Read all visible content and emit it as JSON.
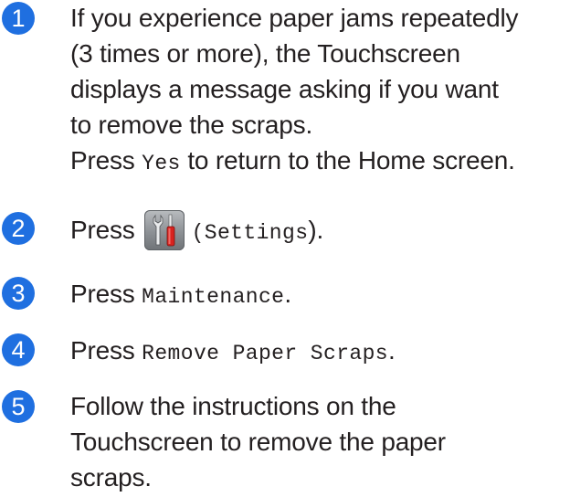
{
  "accent_color": "#1f6fe0",
  "steps": [
    {
      "number": "1",
      "lines": [
        "If you experience paper jams repeatedly",
        "(3 times or more), the Touchscreen",
        "displays a message asking if you want",
        "to remove the scraps."
      ],
      "press_prefix": "Press ",
      "press_button": "Yes",
      "press_suffix": " to return to the Home screen."
    },
    {
      "number": "2",
      "prefix": "Press",
      "icon": "settings-icon",
      "button": "(Settings",
      "suffix": ")."
    },
    {
      "number": "3",
      "prefix": "Press ",
      "button": "Maintenance",
      "suffix": "."
    },
    {
      "number": "4",
      "prefix": "Press ",
      "button": "Remove Paper Scraps",
      "suffix": "."
    },
    {
      "number": "5",
      "lines": [
        "Follow the instructions on the",
        "Touchscreen to remove the paper",
        "scraps."
      ]
    }
  ]
}
